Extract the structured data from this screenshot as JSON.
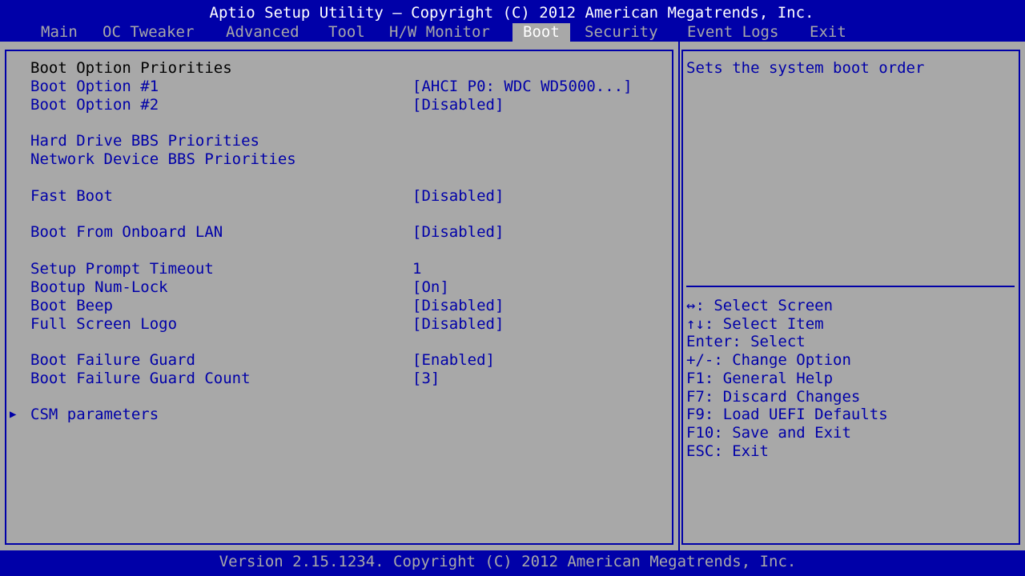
{
  "title": "Aptio Setup Utility – Copyright (C) 2012 American Megatrends, Inc.",
  "tabs": [
    {
      "label": "Main"
    },
    {
      "label": "OC Tweaker"
    },
    {
      "label": "Advanced"
    },
    {
      "label": "Tool"
    },
    {
      "label": "H/W Monitor"
    },
    {
      "label": "Boot"
    },
    {
      "label": "Security"
    },
    {
      "label": "Event Logs"
    },
    {
      "label": "Exit"
    }
  ],
  "active_tab": "Boot",
  "boot": {
    "section_title": "Boot Option Priorities",
    "items": [
      {
        "label": "Boot Option #1",
        "value": "[AHCI P0: WDC WD5000...]"
      },
      {
        "label": "Boot Option #2",
        "value": "[Disabled]"
      },
      {
        "label": "Hard Drive BBS Priorities",
        "value": ""
      },
      {
        "label": "Network Device BBS Priorities",
        "value": ""
      },
      {
        "label": "Fast Boot",
        "value": "[Disabled]"
      },
      {
        "label": "Boot From Onboard LAN",
        "value": "[Disabled]"
      },
      {
        "label": "Setup Prompt Timeout",
        "value": "1"
      },
      {
        "label": "Bootup Num-Lock",
        "value": "[On]"
      },
      {
        "label": "Boot Beep",
        "value": "[Disabled]"
      },
      {
        "label": "Full Screen Logo",
        "value": "[Disabled]"
      },
      {
        "label": "Boot Failure Guard",
        "value": "[Enabled]"
      },
      {
        "label": "Boot Failure Guard Count",
        "value": "[3]"
      },
      {
        "label": "CSM parameters",
        "value": ""
      }
    ],
    "submenu_arrow": "▶"
  },
  "help": {
    "description": "Sets the system boot order",
    "keys": [
      "↔: Select Screen",
      "↑↓: Select Item",
      "Enter: Select",
      "+/-: Change Option",
      "F1: General Help",
      "F7: Discard Changes",
      "F9: Load UEFI Defaults",
      "F10: Save and Exit",
      "ESC: Exit"
    ]
  },
  "footer": "Version 2.15.1234. Copyright (C) 2012 American Megatrends, Inc.",
  "colors": {
    "header_bg": "#0000a8",
    "panel_bg": "#a8a8a8",
    "text_blue": "#0000a8",
    "text_white": "#ffffff"
  }
}
